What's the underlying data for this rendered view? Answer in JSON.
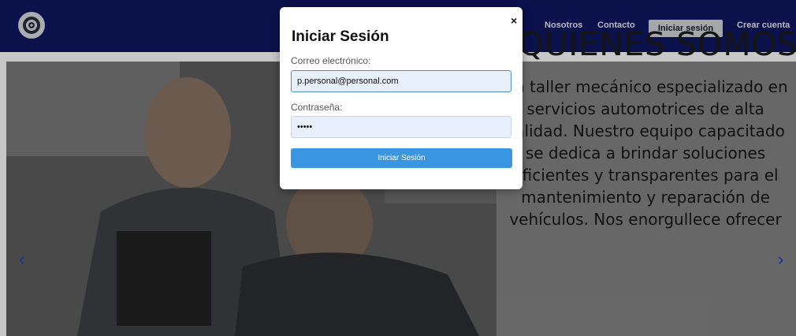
{
  "header": {
    "logo_icon": "gear-wheel-logo-icon",
    "nav": [
      "Nosotros",
      "Contacto"
    ],
    "login_button": "Iniciar sesión",
    "signup_link": "Crear cuenta"
  },
  "hero": {
    "title": "QUIENES SOMOS:",
    "text": "Un taller mecánico especializado en servicios automotrices de alta calidad. Nuestro equipo capacitado se dedica a brindar soluciones eficientes y transparentes para el mantenimiento y reparación de vehículos. Nos enorgullece ofrecer",
    "prev_arrow": "‹",
    "next_arrow": "›"
  },
  "modal": {
    "title": "Iniciar Sesión",
    "close": "×",
    "email_label": "Correo electrónico:",
    "email_value": "p.personal@personal.com",
    "password_label": "Contraseña:",
    "password_value": "•••••",
    "submit": "Iniciar Sesión"
  },
  "colors": {
    "header_bg": "#0f1660",
    "accent": "#3a96e0"
  }
}
